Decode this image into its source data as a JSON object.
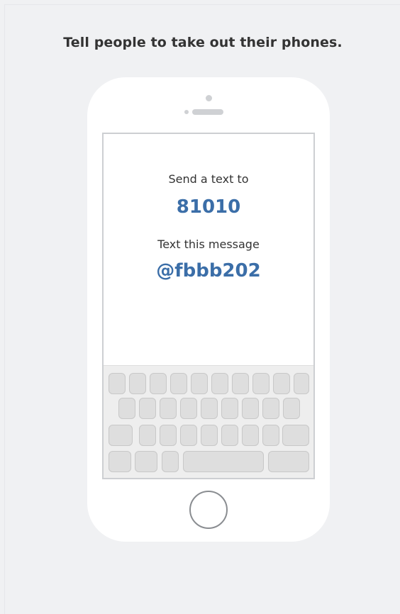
{
  "heading": "Tell people to take out their phones.",
  "screen": {
    "send_label": "Send a text to",
    "phone_number": "81010",
    "message_label": "Text this message",
    "message_code": "@fbbb202"
  },
  "colors": {
    "page_background": "#f0f1f3",
    "heading_text": "#333333",
    "accent_blue": "#3b6ea8"
  },
  "icons": {
    "home_button": "home-button-icon",
    "camera": "camera-icon",
    "speaker": "speaker-icon"
  }
}
